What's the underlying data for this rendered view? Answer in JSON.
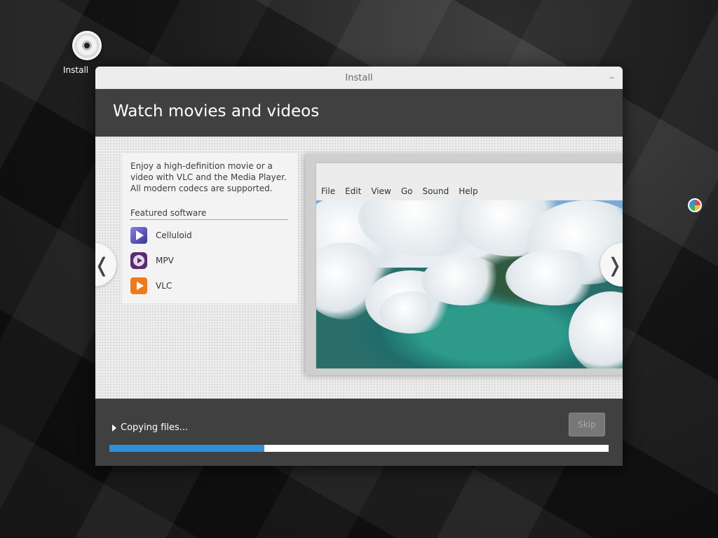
{
  "desktop": {
    "icon_label": "Install"
  },
  "window": {
    "title": "Install",
    "minimize_glyph": "–"
  },
  "header": {
    "title": "Watch movies and videos"
  },
  "slide": {
    "description": "Enjoy a high-definition movie or a video with VLC and the Media Player. All modern codecs are supported.",
    "featured_label": "Featured software",
    "apps": [
      {
        "name": "Celluloid",
        "icon": "celluloid-icon"
      },
      {
        "name": "MPV",
        "icon": "mpv-icon"
      },
      {
        "name": "VLC",
        "icon": "vlc-icon"
      }
    ],
    "player_menu": [
      "File",
      "Edit",
      "View",
      "Go",
      "Sound",
      "Help"
    ],
    "prev_glyph": "❬",
    "next_glyph": "❭"
  },
  "footer": {
    "status": "Copying files...",
    "skip_label": "Skip",
    "progress": 0.31
  },
  "colors": {
    "accent": "#2f8fd8",
    "header_bg": "#404040"
  }
}
